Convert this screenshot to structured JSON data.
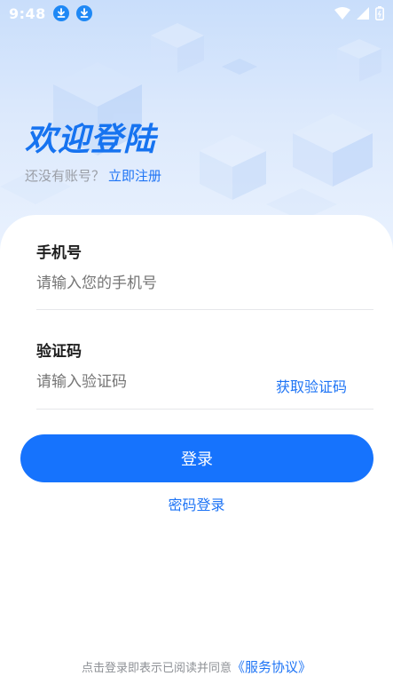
{
  "status_bar": {
    "time": "9:48",
    "icons": [
      "download-icon",
      "download-icon",
      "wifi-icon",
      "signal-icon",
      "battery-icon"
    ]
  },
  "header": {
    "title": "欢迎登陆",
    "no_account_text": "还没有账号？",
    "register_link": "立即注册"
  },
  "form": {
    "phone": {
      "label": "手机号",
      "placeholder": "请输入您的手机号"
    },
    "code": {
      "label": "验证码",
      "placeholder": "请输入验证码",
      "get_code_button": "获取验证码"
    },
    "login_button": "登录",
    "password_login_link": "密码登录"
  },
  "footer": {
    "agreement_prefix": "点击登录即表示已阅读并同意",
    "agreement_link": "《服务协议》"
  },
  "colors": {
    "accent": "#1673FD",
    "title": "#1673F0",
    "link": "#1E74F5",
    "placeholder": "#B7B9BD",
    "hero_bg": "#C9DEFB"
  }
}
